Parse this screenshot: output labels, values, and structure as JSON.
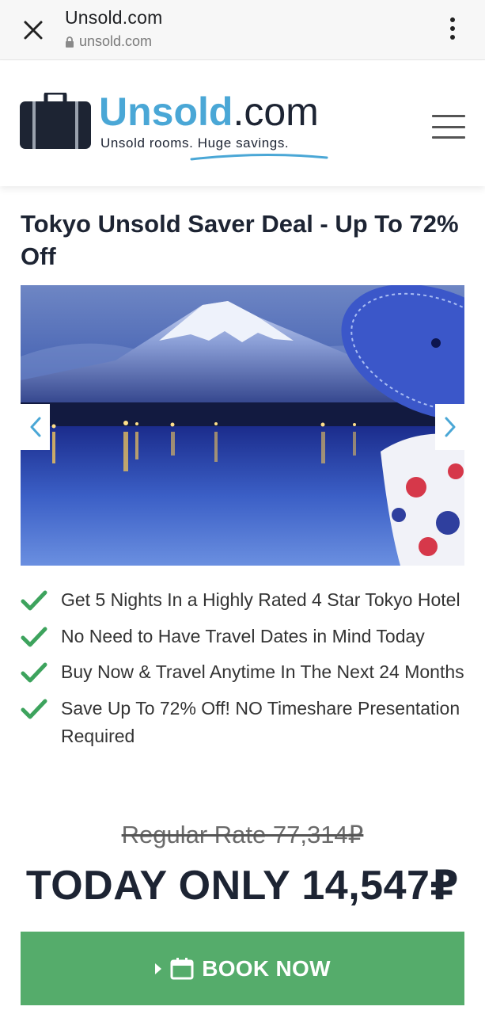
{
  "browser": {
    "title": "Unsold.com",
    "url": "unsold.com",
    "icons": {
      "close": "close-icon",
      "lock": "lock-icon",
      "menu": "more-vertical-icon"
    }
  },
  "header": {
    "logo_brand": "Unsold",
    "logo_suffix": ".com",
    "logo_tagline": "Unsold rooms. Huge savings.",
    "icons": {
      "logo": "suitcase-icon",
      "menu": "hamburger-icon"
    }
  },
  "deal": {
    "title": "Tokyo Unsold Saver Deal - Up To 72% Off",
    "features": [
      "Get 5 Nights In a Highly Rated 4 Star Tokyo Hotel",
      "No Need to Have Travel Dates in Mind Today",
      "Buy Now & Travel Anytime In The Next 24 Months",
      "Save Up To 72% Off! NO Timeshare Presentation Required"
    ],
    "regular_rate": "Regular Rate 77,314₽",
    "today_price": "TODAY ONLY 14,547₽",
    "book_label": "BOOK NOW"
  },
  "colors": {
    "accent_blue": "#4aa7d6",
    "navy": "#1d2433",
    "book_green": "#55ac6b",
    "check_green": "#3da35d"
  }
}
